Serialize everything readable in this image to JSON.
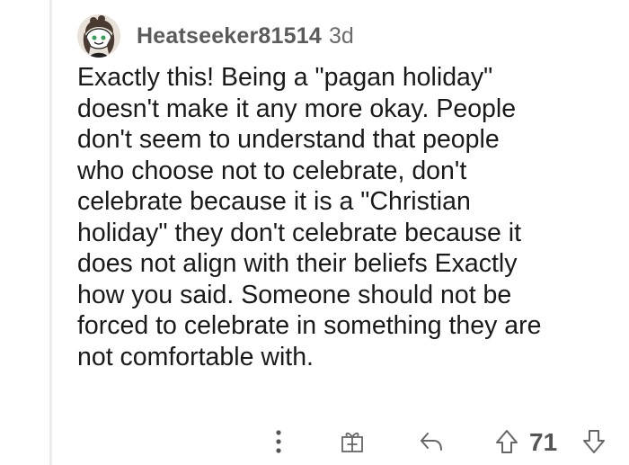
{
  "comment": {
    "author": "Heatseeker81514",
    "age": "3d",
    "body": "Exactly this! Being a \"pagan holiday\"\ndoesn't make it any more okay. People\ndon't seem to understand that people\nwho choose not to celebrate, don't\ncelebrate because it is a \"Christian\nholiday\" they don't  celebrate because it\ndoes not align with their beliefs Exactly\nhow you said. Someone should not be\nforced to celebrate in something they are\nnot comfortable with.",
    "score": "71"
  },
  "icons": {
    "avatar": "snoo-avatar",
    "more": "more-options-icon",
    "award": "award-gift-icon",
    "reply": "reply-arrow-icon",
    "upvote": "upvote-arrow-icon",
    "downvote": "downvote-arrow-icon"
  },
  "colors": {
    "username": "#5b5b5b",
    "text": "#1a1a1b",
    "icon": "#6b6b6b",
    "thread_line": "#ececec"
  }
}
